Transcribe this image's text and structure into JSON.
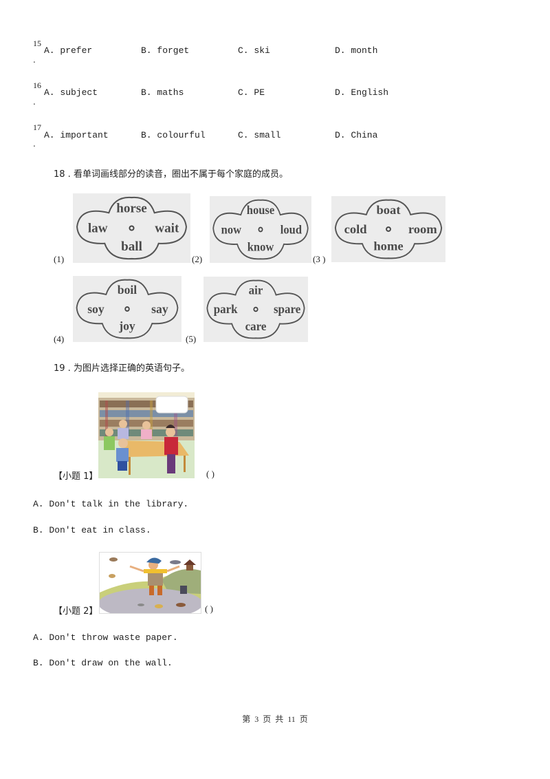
{
  "questions_choice": [
    {
      "number": "15",
      "options": [
        "A. prefer",
        "B. forget",
        "C. ski",
        "D. month"
      ]
    },
    {
      "number": "16",
      "options": [
        "A. subject",
        "B. maths",
        "C. PE",
        "D. English"
      ]
    },
    {
      "number": "17",
      "options": [
        "A. important",
        "B. colourful",
        "C. small",
        "D. China"
      ]
    }
  ],
  "q18": {
    "title": "18 . 看单词画线部分的读音，圈出不属于每个家庭的成员。",
    "clouds": [
      {
        "label": "(1)",
        "top": "horse",
        "left": "law",
        "right": "wait",
        "bottom": "ball"
      },
      {
        "label": "(2)",
        "top": "house",
        "left": "now",
        "right": "loud",
        "bottom": "know"
      },
      {
        "label": "(3 )",
        "top": "boat",
        "left": "cold",
        "right": "room",
        "bottom": "home"
      },
      {
        "label": "(4)",
        "top": "boil",
        "left": "soy",
        "right": "say",
        "bottom": "joy"
      },
      {
        "label": "(5)",
        "top": "air",
        "left": "park",
        "right": "spare",
        "bottom": "care"
      }
    ]
  },
  "q19": {
    "title": "19 . 为图片选择正确的英语句子。",
    "subquestions": [
      {
        "label": "【小题 1】",
        "bracket": "(      )",
        "picture": "library-scene",
        "options": [
          "A. Don't talk in the library.",
          "B. Don't eat in class."
        ]
      },
      {
        "label": "【小题 2】",
        "bracket": "(      )",
        "picture": "litter-scene",
        "options": [
          "A. Don't throw waste paper.",
          "B. Don't draw on the wall."
        ]
      }
    ]
  },
  "footer": {
    "page_text": "第 3 页 共 11 页"
  }
}
